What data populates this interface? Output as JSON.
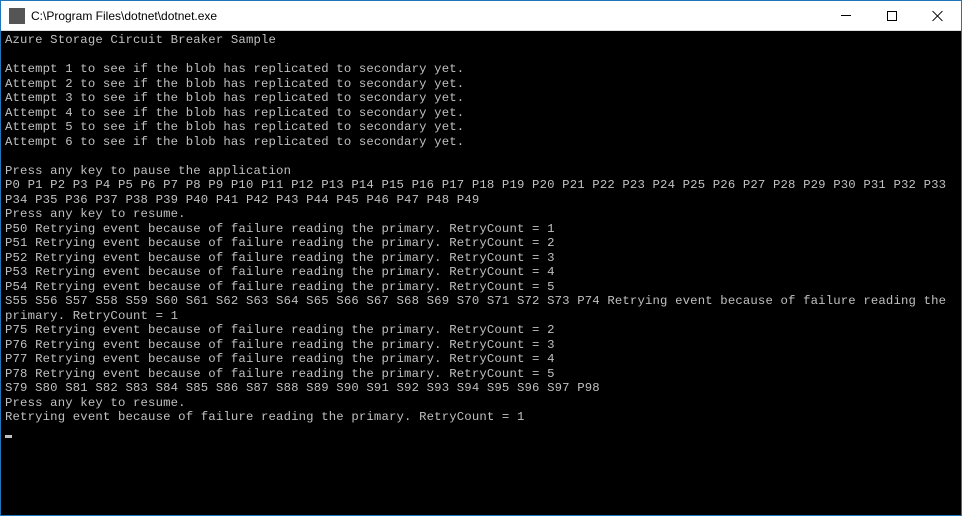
{
  "window": {
    "title": "C:\\Program Files\\dotnet\\dotnet.exe"
  },
  "console": {
    "header": "Azure Storage Circuit Breaker Sample",
    "attempts": [
      "Attempt 1 to see if the blob has replicated to secondary yet.",
      "Attempt 2 to see if the blob has replicated to secondary yet.",
      "Attempt 3 to see if the blob has replicated to secondary yet.",
      "Attempt 4 to see if the blob has replicated to secondary yet.",
      "Attempt 5 to see if the blob has replicated to secondary yet.",
      "Attempt 6 to see if the blob has replicated to secondary yet."
    ],
    "pause_prompt": "Press any key to pause the application",
    "initial_sequence": "P0 P1 P2 P3 P4 P5 P6 P7 P8 P9 P10 P11 P12 P13 P14 P15 P16 P17 P18 P19 P20 P21 P22 P23 P24 P25 P26 P27 P28 P29 P30 P31 P32 P33 P34 P35 P36 P37 P38 P39 P40 P41 P42 P43 P44 P45 P46 P47 P48 P49",
    "resume1": "Press any key to resume.",
    "retries1": [
      "P50 Retrying event because of failure reading the primary. RetryCount = 1",
      "P51 Retrying event because of failure reading the primary. RetryCount = 2",
      "P52 Retrying event because of failure reading the primary. RetryCount = 3",
      "P53 Retrying event because of failure reading the primary. RetryCount = 4",
      "P54 Retrying event because of failure reading the primary. RetryCount = 5"
    ],
    "secondary_switch": "S55 S56 S57 S58 S59 S60 S61 S62 S63 S64 S65 S66 S67 S68 S69 S70 S71 S72 S73 P74 Retrying event because of failure reading the primary. RetryCount = 1",
    "retries2": [
      "P75 Retrying event because of failure reading the primary. RetryCount = 2",
      "P76 Retrying event because of failure reading the primary. RetryCount = 3",
      "P77 Retrying event because of failure reading the primary. RetryCount = 4",
      "P78 Retrying event because of failure reading the primary. RetryCount = 5"
    ],
    "secondary_switch2": "S79 S80 S81 S82 S83 S84 S85 S86 S87 S88 S89 S90 S91 S92 S93 S94 S95 S96 S97 P98",
    "resume2": "Press any key to resume.",
    "final_retry": "Retrying event because of failure reading the primary. RetryCount = 1"
  }
}
